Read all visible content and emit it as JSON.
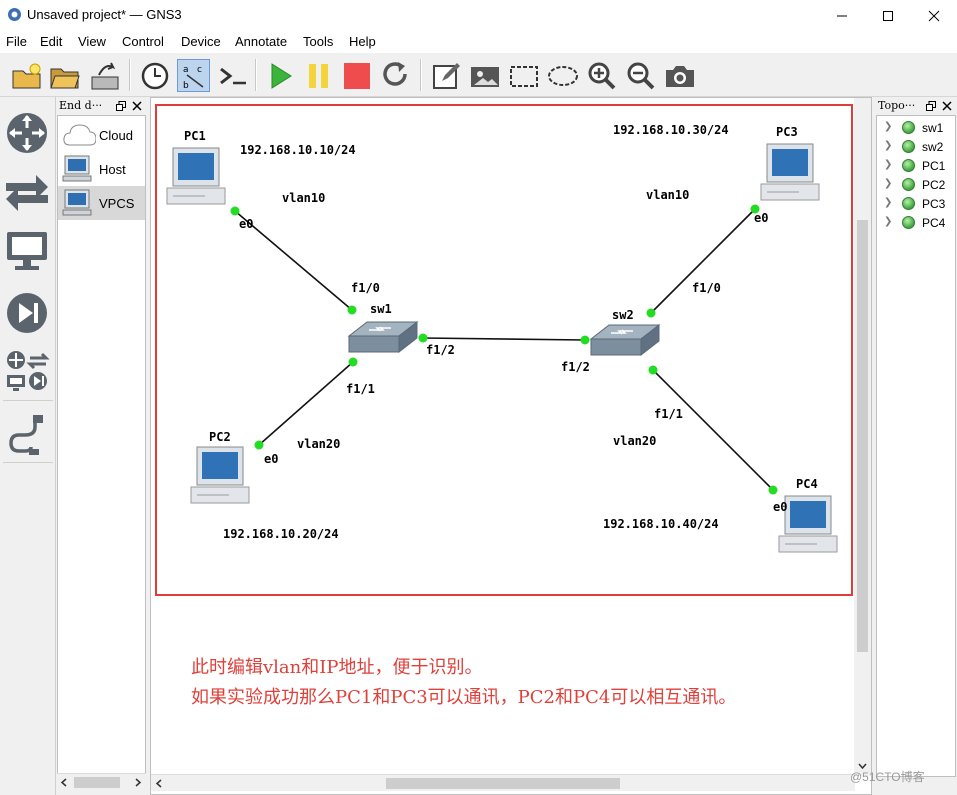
{
  "window": {
    "title": "Unsaved project* — GNS3"
  },
  "menu": [
    "File",
    "Edit",
    "View",
    "Control",
    "Device",
    "Annotate",
    "Tools",
    "Help"
  ],
  "end_devices_dock": {
    "title": "End d···",
    "items": [
      {
        "label": "Cloud",
        "icon": "cloud-icon"
      },
      {
        "label": "Host",
        "icon": "host-icon"
      },
      {
        "label": "VPCS",
        "icon": "vpcs-icon"
      }
    ]
  },
  "topology_dock": {
    "title": "Topo···",
    "nodes": [
      "sw1",
      "sw2",
      "PC1",
      "PC2",
      "PC3",
      "PC4"
    ]
  },
  "topology": {
    "devices": {
      "pc1": {
        "name": "PC1",
        "ip": "192.168.10.10/24",
        "vlan": "vlan10",
        "port": "e0"
      },
      "pc2": {
        "name": "PC2",
        "ip": "192.168.10.20/24",
        "vlan": "vlan20",
        "port": "e0"
      },
      "pc3": {
        "name": "PC3",
        "ip": "192.168.10.30/24",
        "vlan": "vlan10",
        "port": "e0"
      },
      "pc4": {
        "name": "PC4",
        "ip": "192.168.10.40/24",
        "vlan": "vlan20",
        "port": "e0"
      },
      "sw1": {
        "name": "sw1",
        "p10": "f1/0",
        "p11": "f1/1",
        "p12": "f1/2"
      },
      "sw2": {
        "name": "sw2",
        "p10": "f1/0",
        "p11": "f1/1",
        "p12": "f1/2"
      }
    }
  },
  "notes": {
    "line1": "此时编辑vlan和IP地址，便于识别。",
    "line2": "如果实验成功那么PC1和PC3可以通讯，PC2和PC4可以相互通讯。"
  },
  "watermark": "@51CTO博客",
  "colors": {
    "annotation": "#e03c3c",
    "link_dot": "#22dd22"
  }
}
